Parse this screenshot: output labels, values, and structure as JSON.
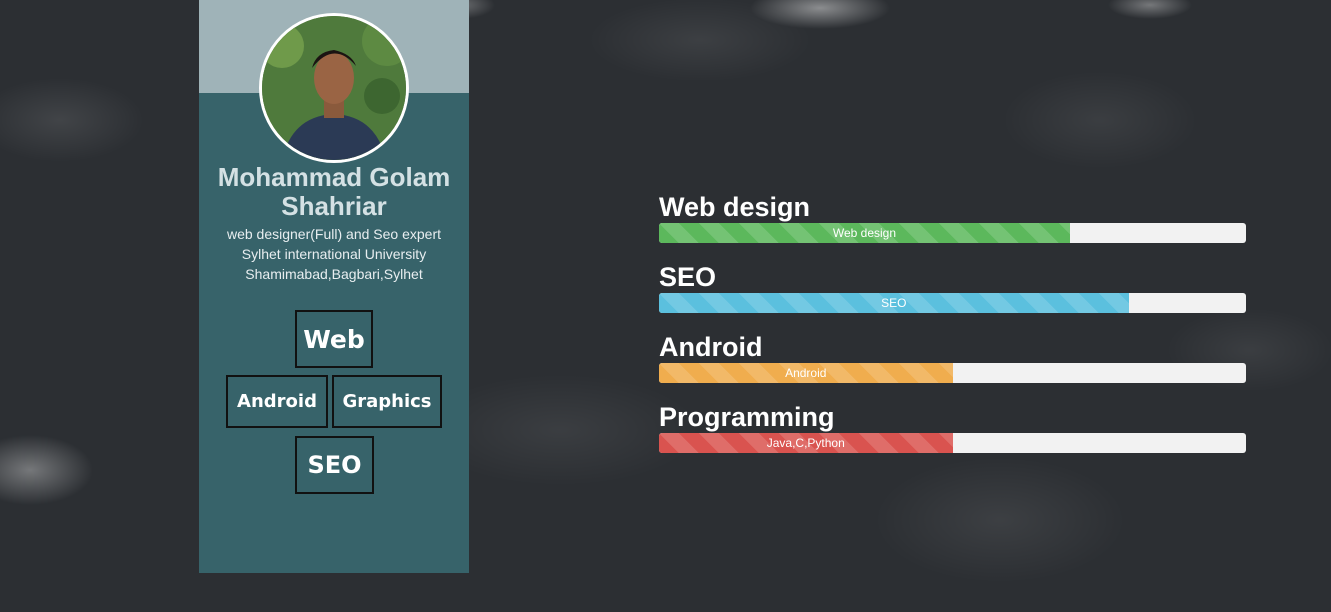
{
  "profile": {
    "name": "Mohammad Golam Shahriar",
    "role": "web designer(Full) and Seo expert",
    "university": "Sylhet international University",
    "address": "Shamimabad,Bagbari,Sylhet"
  },
  "skill_buttons": {
    "web": "Web",
    "android": "Android",
    "graphics": "Graphics",
    "seo": "SEO"
  },
  "skills": [
    {
      "title": "Web design",
      "bar_label": "Web design",
      "percent": 70,
      "color": "#5cb85c"
    },
    {
      "title": "SEO",
      "bar_label": "SEO",
      "percent": 80,
      "color": "#5bc0de"
    },
    {
      "title": "Android",
      "bar_label": "Android",
      "percent": 50,
      "color": "#f0ad4e"
    },
    {
      "title": "Programming",
      "bar_label": "Java,C,Python",
      "percent": 50,
      "color": "#d9534f"
    }
  ]
}
